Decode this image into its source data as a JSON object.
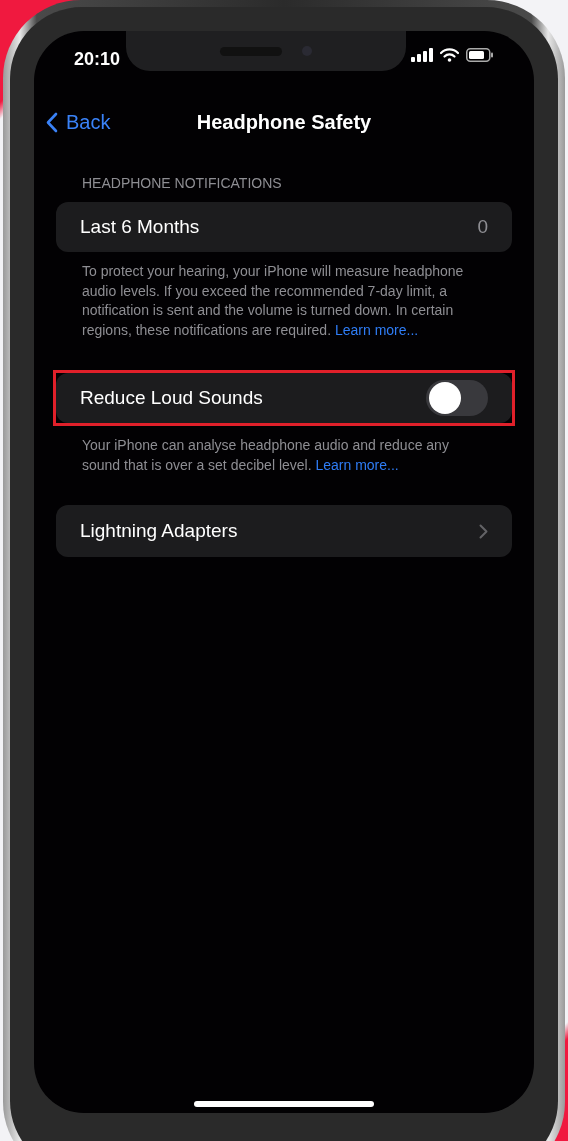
{
  "status_bar": {
    "time": "20:10"
  },
  "nav": {
    "back": "Back",
    "title": "Headphone Safety"
  },
  "sections": [
    {
      "kind": "value",
      "header": "HEADPHONE NOTIFICATIONS",
      "label": "Last 6 Months",
      "value": "0",
      "footer": "To protect your hearing, your iPhone will measure headphone audio levels. If you exceed the recommended 7-day limit, a notification is sent and the volume is turned down. In certain regions, these notifications are required.",
      "link": "Learn more..."
    },
    {
      "kind": "toggle",
      "label": "Reduce Loud Sounds",
      "on": false,
      "highlighted": true,
      "footer": "Your iPhone can analyse headphone audio and reduce any sound that is over a set decibel level.",
      "link": "Learn more..."
    },
    {
      "kind": "disclosure",
      "label": "Lightning Adapters"
    }
  ]
}
